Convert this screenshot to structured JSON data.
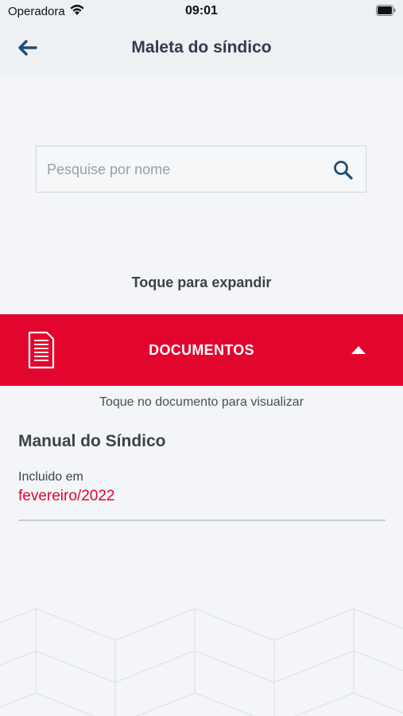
{
  "status_bar": {
    "carrier": "Operadora",
    "time": "09:01"
  },
  "header": {
    "title": "Maleta do síndico"
  },
  "search": {
    "placeholder": "Pesquise por nome",
    "value": ""
  },
  "expand_hint": "Toque para expandir",
  "section": {
    "title": "DOCUMENTOS",
    "expanded": true,
    "hint": "Toque no documento para visualizar",
    "items": [
      {
        "name": "Manual do Síndico",
        "included_label": "Incluido em",
        "included_date": "fevereiro/2022"
      }
    ]
  },
  "colors": {
    "accent_red": "#e2062f",
    "header_bg": "#eef1f4",
    "page_bg": "#f3f5f9",
    "nav_icon": "#1d4c72"
  },
  "icons": [
    "wifi-icon",
    "battery-icon",
    "back-arrow-icon",
    "search-icon",
    "document-icon",
    "caret-up-icon"
  ]
}
